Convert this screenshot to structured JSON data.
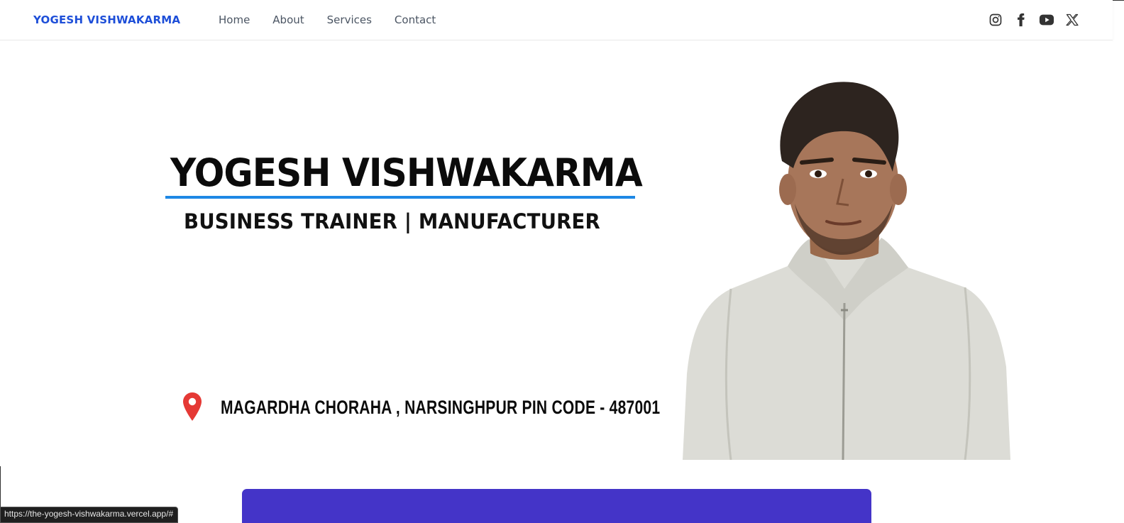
{
  "navbar": {
    "brand": "YOGESH VISHWAKARMA",
    "links": [
      "Home",
      "About",
      "Services",
      "Contact"
    ],
    "socials": [
      "instagram-icon",
      "facebook-icon",
      "youtube-icon",
      "x-icon"
    ]
  },
  "hero": {
    "name": "YOGESH VISHWAKARMA",
    "subtitle": "BUSINESS TRAINER | MANUFACTURER",
    "address": "MAGARDHA CHORAHA , NARSINGHPUR PIN CODE - 487001"
  },
  "status_bar": {
    "url": "https://the-yogesh-vishwakarma.vercel.app/#"
  },
  "colors": {
    "brand": "#1d4ed8",
    "underline": "#1e88e5",
    "pin": "#e53935",
    "purple": "#4434c8"
  }
}
